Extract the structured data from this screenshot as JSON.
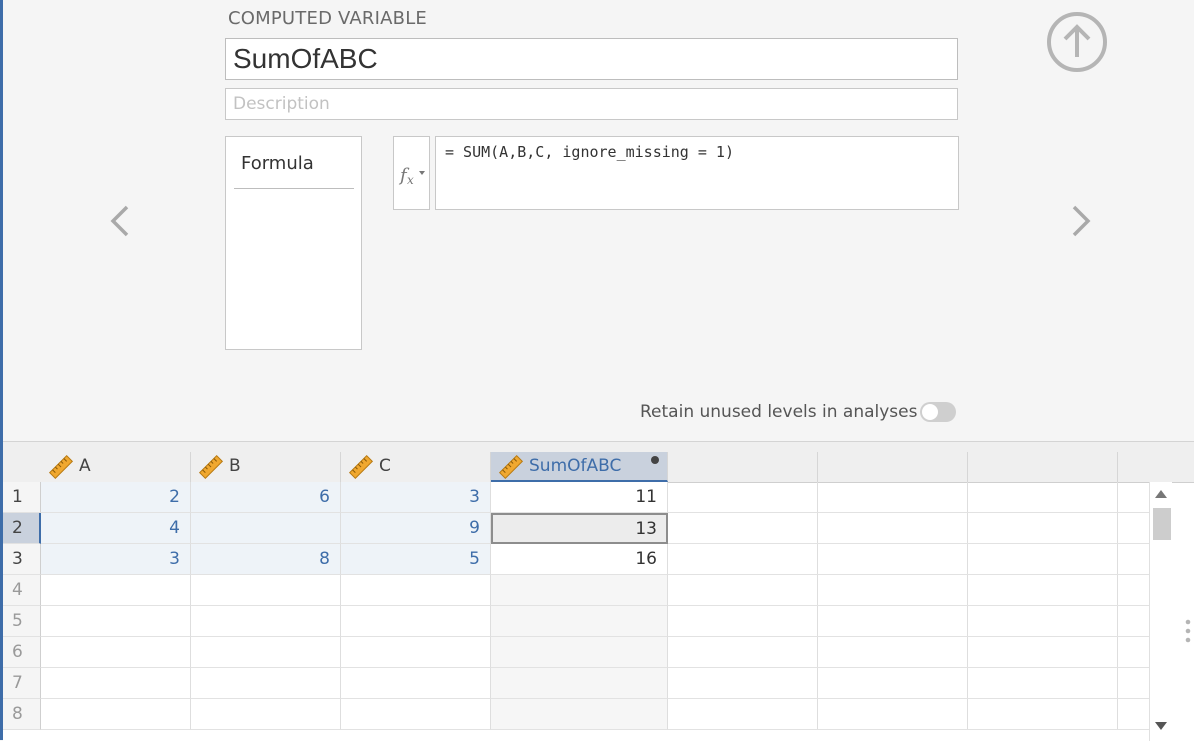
{
  "setup": {
    "heading": "COMPUTED VARIABLE",
    "name": "SumOfABC",
    "description_placeholder": "Description",
    "formula_tab_label": "Formula",
    "formula": "= SUM(A,B,C, ignore_missing = 1)",
    "retain_label": "Retain unused levels in analyses",
    "retain_on": false
  },
  "icons": {
    "prev": "chevron-left-icon",
    "next": "chevron-right-icon",
    "collapse": "arrow-up-circle-icon",
    "fx": "function-icon",
    "column_type": "ruler-icon"
  },
  "grid": {
    "columns": [
      {
        "label": "A",
        "type": "continuous"
      },
      {
        "label": "B",
        "type": "continuous"
      },
      {
        "label": "C",
        "type": "continuous"
      },
      {
        "label": "SumOfABC",
        "type": "computed",
        "active": true
      }
    ],
    "row_numbers": [
      "1",
      "2",
      "3",
      "4",
      "5",
      "6",
      "7",
      "8"
    ],
    "rows": [
      [
        "2",
        "6",
        "3",
        "11"
      ],
      [
        "4",
        "",
        "9",
        "13"
      ],
      [
        "3",
        "8",
        "5",
        "16"
      ]
    ],
    "selected_row": 2
  },
  "colors": {
    "accent": "#3e6da9",
    "ruler": "#f0a830"
  }
}
